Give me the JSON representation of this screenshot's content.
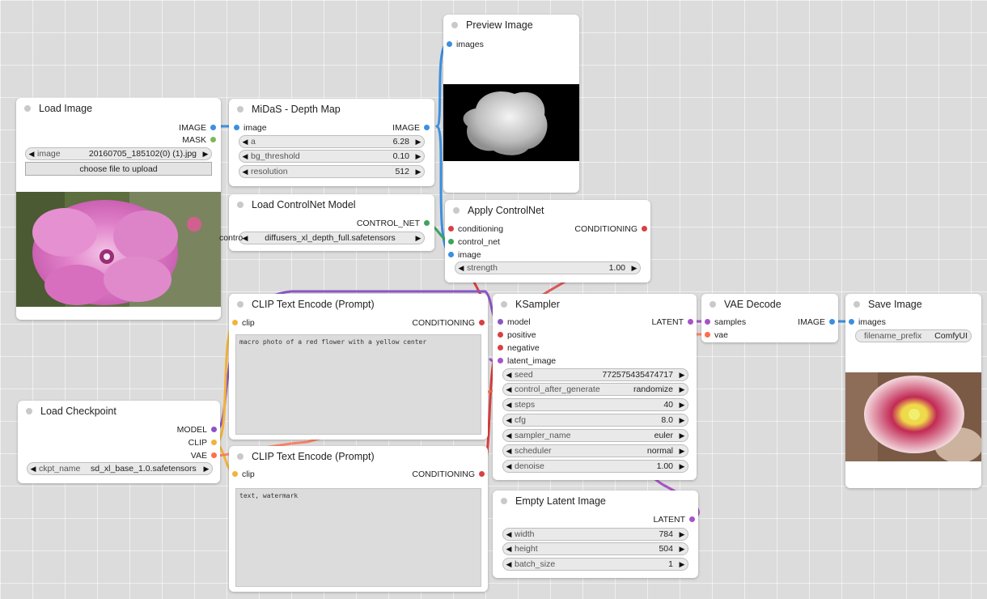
{
  "colors": {
    "image": "#3b8fe0",
    "mask": "#7fb85a",
    "model": "#8b55c6",
    "clip": "#f2b33d",
    "vae": "#ff6e4a",
    "conditioning": "#d94040",
    "control_net": "#3fa25e",
    "latent": "#a553c7"
  },
  "nodes": {
    "load_image": {
      "title": "Load Image",
      "outputs": [
        "IMAGE",
        "MASK"
      ],
      "image_widget": {
        "label": "image",
        "value": "20160705_185102(0) (1).jpg"
      },
      "upload_label": "choose file to upload",
      "picture": "pink flower photo"
    },
    "midas": {
      "title": "MiDaS - Depth Map",
      "input": "image",
      "output": "IMAGE",
      "widgets": [
        {
          "label": "a",
          "value": "6.28"
        },
        {
          "label": "bg_threshold",
          "value": "0.10"
        },
        {
          "label": "resolution",
          "value": "512"
        }
      ]
    },
    "preview": {
      "title": "Preview Image",
      "input": "images",
      "picture": "depth map preview"
    },
    "controlnet_loader": {
      "title": "Load ControlNet Model",
      "output": "CONTROL_NET",
      "widget_label": "control_net_name",
      "widget_value": "diffusers_xl_depth_full.safetensors",
      "overlap_text": "contro"
    },
    "apply_controlnet": {
      "title": "Apply ControlNet",
      "inputs": [
        "conditioning",
        "control_net",
        "image"
      ],
      "output": "CONDITIONING",
      "widget": {
        "label": "strength",
        "value": "1.00"
      }
    },
    "clip_pos": {
      "title": "CLIP Text Encode (Prompt)",
      "input": "clip",
      "output": "CONDITIONING",
      "text": "macro photo of a red flower with a yellow center"
    },
    "clip_neg": {
      "title": "CLIP Text Encode (Prompt)",
      "input": "clip",
      "output": "CONDITIONING",
      "text": "text, watermark"
    },
    "ksampler": {
      "title": "KSampler",
      "inputs": [
        "model",
        "positive",
        "negative",
        "latent_image"
      ],
      "output": "LATENT",
      "widgets": [
        {
          "label": "seed",
          "value": "772575435474717"
        },
        {
          "label": "control_after_generate",
          "value": "randomize"
        },
        {
          "label": "steps",
          "value": "40"
        },
        {
          "label": "cfg",
          "value": "8.0"
        },
        {
          "label": "sampler_name",
          "value": "euler"
        },
        {
          "label": "scheduler",
          "value": "normal"
        },
        {
          "label": "denoise",
          "value": "1.00"
        }
      ]
    },
    "vae_decode": {
      "title": "VAE Decode",
      "inputs": [
        "samples",
        "vae"
      ],
      "output": "IMAGE"
    },
    "save_image": {
      "title": "Save Image",
      "input": "images",
      "widget": {
        "label": "filename_prefix",
        "value": "ComfyUI"
      },
      "picture": "generated flower image"
    },
    "load_checkpoint": {
      "title": "Load Checkpoint",
      "outputs": [
        "MODEL",
        "CLIP",
        "VAE"
      ],
      "widget": {
        "label": "ckpt_name",
        "value": "sd_xl_base_1.0.safetensors"
      }
    },
    "empty_latent": {
      "title": "Empty Latent Image",
      "output": "LATENT",
      "widgets": [
        {
          "label": "width",
          "value": "784"
        },
        {
          "label": "height",
          "value": "504"
        },
        {
          "label": "batch_size",
          "value": "1"
        }
      ]
    }
  }
}
